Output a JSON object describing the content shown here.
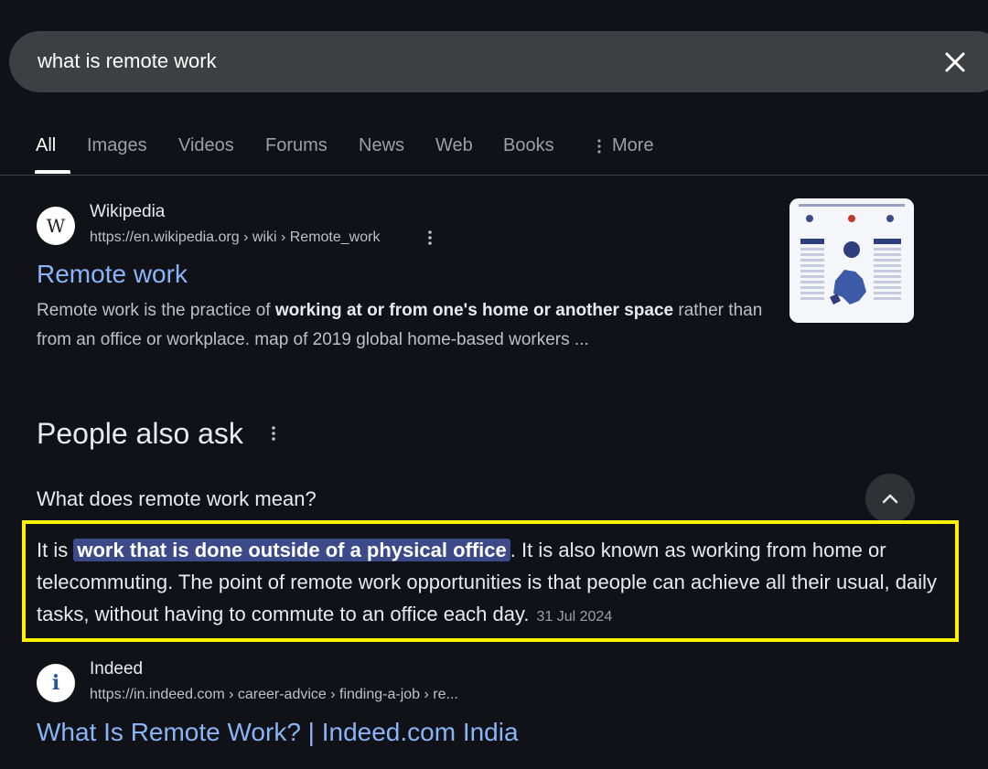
{
  "search": {
    "query": "what is remote work"
  },
  "tabs": [
    {
      "label": "All",
      "active": true
    },
    {
      "label": "Images"
    },
    {
      "label": "Videos"
    },
    {
      "label": "Forums"
    },
    {
      "label": "News"
    },
    {
      "label": "Web"
    },
    {
      "label": "Books"
    },
    {
      "label": "More"
    }
  ],
  "result1": {
    "site": "Wikipedia",
    "favicon_letter": "W",
    "url": "https://en.wikipedia.org › wiki › Remote_work",
    "title": "Remote work",
    "snippet_pre": "Remote work is the practice of ",
    "snippet_bold": "working at or from one's home or another space",
    "snippet_post": " rather than from an office or workplace. map of 2019 global home-based workers ..."
  },
  "paa": {
    "title": "People also ask",
    "question": "What does remote work mean?",
    "answer_pre": "It is ",
    "answer_highlight": "work that is done outside of a physical office",
    "answer_post": ". It is also known as working from home or telecommuting. The point of remote work opportunities is that people can achieve all their usual, daily tasks, without having to commute to an office each day.",
    "date": "31 Jul 2024"
  },
  "result2": {
    "site": "Indeed",
    "favicon_letter": "i",
    "url": "https://in.indeed.com › career-advice › finding-a-job › re...",
    "title": "What Is Remote Work? | Indeed.com India"
  },
  "colors": {
    "background": "#101218",
    "link": "#8ab4f8",
    "highlight_border": "#fff200"
  }
}
